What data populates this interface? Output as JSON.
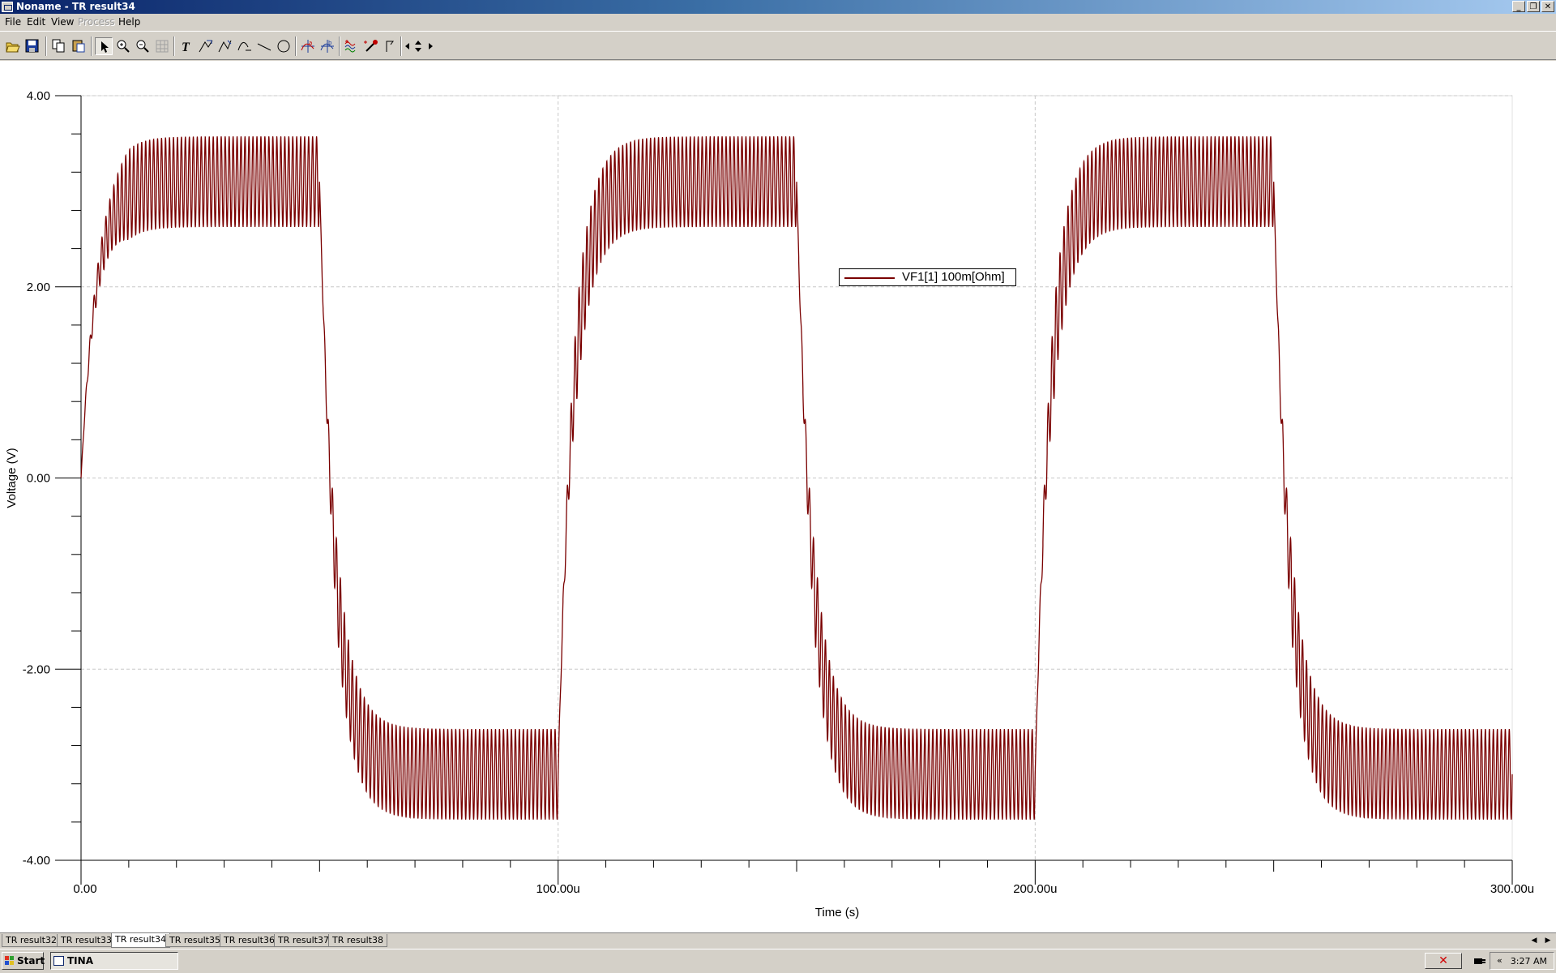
{
  "window": {
    "title": "Noname - TR result34"
  },
  "menu": [
    {
      "label": "File",
      "enabled": true
    },
    {
      "label": "Edit",
      "enabled": true
    },
    {
      "label": "View",
      "enabled": true
    },
    {
      "label": "Process",
      "enabled": false
    },
    {
      "label": "Help",
      "enabled": true
    }
  ],
  "toolbar": {
    "icons": [
      "open-icon",
      "save-icon",
      "copy-icon",
      "paste-icon",
      "select-arrow-icon",
      "zoom-in-icon",
      "zoom-out-icon",
      "grid-icon",
      "text-icon",
      "marker-icon",
      "cursor-a-icon",
      "curve-icon",
      "line-icon",
      "circle-icon",
      "cursor-a-cross-icon",
      "cursor-b-cross-icon",
      "wave-icon",
      "probe-icon",
      "flag-icon",
      "scroll-left-icon",
      "scroll-updown-icon",
      "scroll-right-icon"
    ]
  },
  "chart_data": {
    "type": "line",
    "title": "",
    "xlabel": "Time (s)",
    "ylabel": "Voltage (V)",
    "xlim": [
      0,
      300
    ],
    "ylim": [
      -4,
      4
    ],
    "x_unit": "u",
    "x_major_ticks": [
      "0.00",
      "100.00u",
      "200.00u",
      "300.00u"
    ],
    "y_major_ticks": [
      "4.00",
      "2.00",
      "0.00",
      "-2.00",
      "-4.00"
    ],
    "grid": "dashed-major",
    "legend_position": "top-right",
    "series": [
      {
        "name": "VF1[1]  100m[Ohm]",
        "color": "#7a0000",
        "description_of_shape": "square wave with ringing",
        "period_us": 100,
        "high_mean": 3.1,
        "low_mean": -3.1,
        "ripple_amplitude": 0.47,
        "ripple_cycles_per_half_period": 60,
        "transitions_us": [
          50,
          100,
          150,
          200,
          250
        ]
      }
    ]
  },
  "tabs": [
    "TR result32",
    "TR result33",
    "TR result34",
    "TR result35",
    "TR result36",
    "TR result37",
    "TR result38"
  ],
  "active_tab": "TR result34",
  "taskbar": {
    "start_label": "Start",
    "task_label": "TINA",
    "clock": "3:27 AM",
    "chevron": "«"
  }
}
